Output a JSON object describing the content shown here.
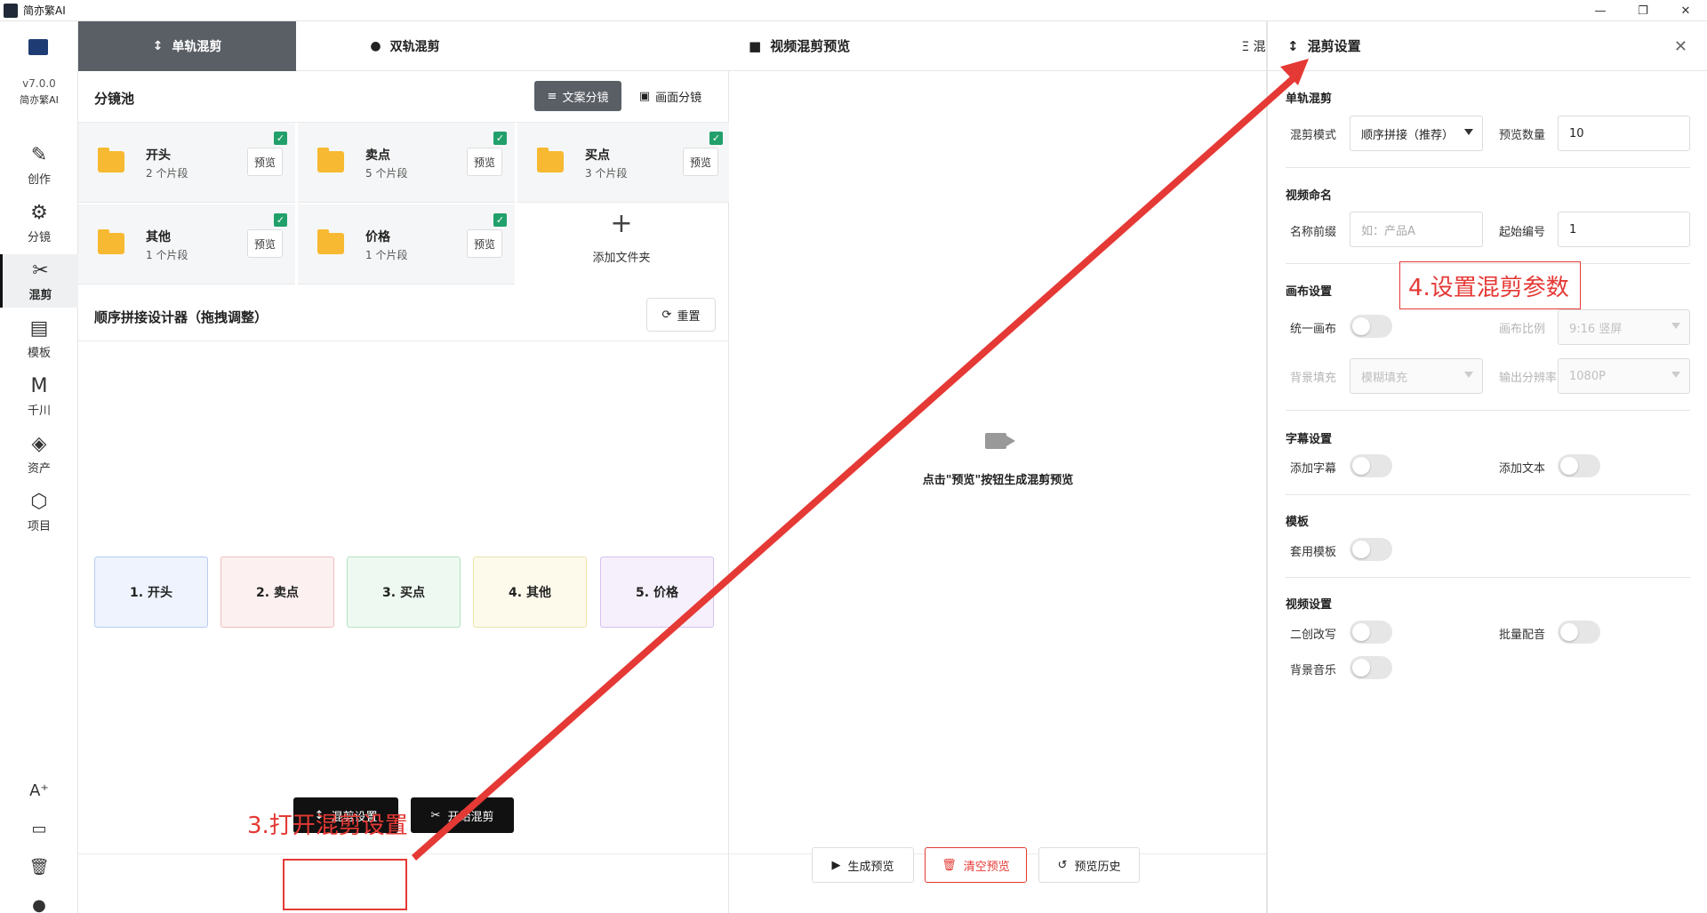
{
  "window": {
    "title": "简亦繁AI",
    "minimize": "—",
    "maximize": "❐",
    "close": "✕"
  },
  "sidebar": {
    "version": "v7.0.0",
    "app_name": "简亦繁AI",
    "items": [
      {
        "label": "创作",
        "icon": "✎"
      },
      {
        "label": "分镜",
        "icon": "⚙"
      },
      {
        "label": "混剪",
        "icon": "✂"
      },
      {
        "label": "模板",
        "icon": "▤"
      },
      {
        "label": "千川",
        "icon": "M"
      },
      {
        "label": "资产",
        "icon": "◈"
      },
      {
        "label": "项目",
        "icon": "⬡"
      }
    ],
    "bottom": [
      "A⁺",
      "▭",
      "🗑",
      "●"
    ]
  },
  "tabs": {
    "single": "单轨混剪",
    "dual": "双轨混剪",
    "single_icon": "↕",
    "dual_icon": "●"
  },
  "pool": {
    "title": "分镜池",
    "btn_script": "文案分镜",
    "btn_frame": "画面分镜",
    "preview": "预览",
    "check": "✓",
    "cards": [
      {
        "name": "开头",
        "count": "2 个片段"
      },
      {
        "name": "卖点",
        "count": "5 个片段"
      },
      {
        "name": "买点",
        "count": "3 个片段"
      },
      {
        "name": "其他",
        "count": "1 个片段"
      },
      {
        "name": "价格",
        "count": "1 个片段"
      }
    ],
    "add_plus": "+",
    "add_label": "添加文件夹"
  },
  "sequence": {
    "title": "顺序拼接设计器（拖拽调整）",
    "reset": "重置",
    "blocks": [
      "1. 开头",
      "2. 卖点",
      "3. 买点",
      "4. 其他",
      "5. 价格"
    ]
  },
  "left_footer": {
    "mix_settings": "混剪设置",
    "start_mix": "开始混剪"
  },
  "preview_panel": {
    "title": "视频混剪预览",
    "hint": "点击\"预览\"按钮生成混剪预览",
    "generate": "生成预览",
    "clear": "清空预览",
    "history": "预览历史"
  },
  "settings": {
    "title": "混剪设置",
    "close": "✕",
    "peek": "Ξ 混",
    "single": {
      "title": "单轨混剪",
      "mode_label": "混剪模式",
      "mode_value": "顺序拼接（推荐）",
      "count_label": "预览数量",
      "count_value": "10"
    },
    "naming": {
      "title": "视频命名",
      "prefix_label": "名称前缀",
      "prefix_placeholder": "如：产品A",
      "start_label": "起始编号",
      "start_value": "1"
    },
    "canvas": {
      "title": "画布设置",
      "unify_label": "统一画布",
      "ratio_label": "画布比例",
      "ratio_value": "9:16 竖屏",
      "fill_label": "背景填充",
      "fill_value": "模糊填充",
      "res_label": "输出分辨率",
      "res_value": "1080P"
    },
    "subtitle": {
      "title": "字幕设置",
      "add_sub": "添加字幕",
      "add_text": "添加文本"
    },
    "template": {
      "title": "模板",
      "apply": "套用模板"
    },
    "video": {
      "title": "视频设置",
      "rewrite": "二创改写",
      "dubbing": "批量配音",
      "bgm": "背景音乐"
    }
  },
  "annotations": {
    "step3": "3.打开混剪设置",
    "step4": "4.设置混剪参数",
    "accent": "#e53935"
  }
}
